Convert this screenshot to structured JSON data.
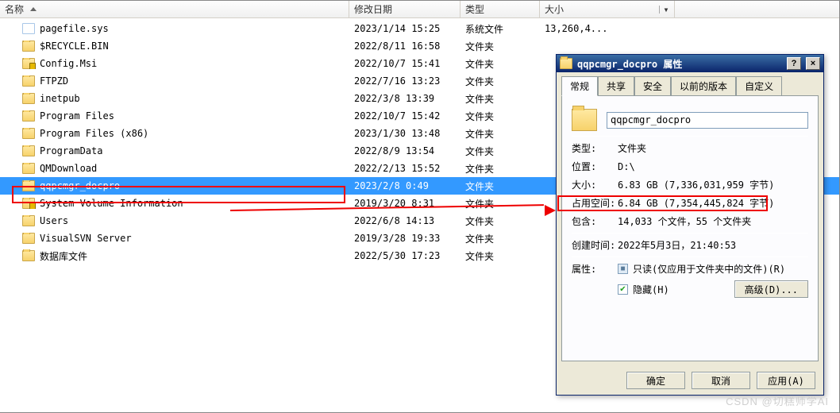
{
  "explorer": {
    "columns": {
      "name": "名称",
      "date": "修改日期",
      "type": "类型",
      "size": "大小"
    },
    "rows": [
      {
        "icon": "file",
        "name": "pagefile.sys",
        "date": "2023/1/14 15:25",
        "type": "系统文件",
        "size": "13,260,4..."
      },
      {
        "icon": "folder",
        "name": "$RECYCLE.BIN",
        "date": "2022/8/11 16:58",
        "type": "文件夹",
        "size": ""
      },
      {
        "icon": "folder-lock",
        "name": "Config.Msi",
        "date": "2022/10/7 15:41",
        "type": "文件夹",
        "size": ""
      },
      {
        "icon": "folder",
        "name": "FTPZD",
        "date": "2022/7/16 13:23",
        "type": "文件夹",
        "size": ""
      },
      {
        "icon": "folder",
        "name": "inetpub",
        "date": "2022/3/8 13:39",
        "type": "文件夹",
        "size": ""
      },
      {
        "icon": "folder",
        "name": "Program Files",
        "date": "2022/10/7 15:42",
        "type": "文件夹",
        "size": ""
      },
      {
        "icon": "folder",
        "name": "Program Files (x86)",
        "date": "2023/1/30 13:48",
        "type": "文件夹",
        "size": ""
      },
      {
        "icon": "folder",
        "name": "ProgramData",
        "date": "2022/8/9 13:54",
        "type": "文件夹",
        "size": ""
      },
      {
        "icon": "folder",
        "name": "QMDownload",
        "date": "2022/2/13 15:52",
        "type": "文件夹",
        "size": ""
      },
      {
        "icon": "folder",
        "name": "qqpcmgr_docpro",
        "date": "2023/2/8 0:49",
        "type": "文件夹",
        "size": "",
        "selected": true
      },
      {
        "icon": "folder-lock",
        "name": "System Volume Information",
        "date": "2019/3/20 8:31",
        "type": "文件夹",
        "size": ""
      },
      {
        "icon": "folder",
        "name": "Users",
        "date": "2022/6/8 14:13",
        "type": "文件夹",
        "size": ""
      },
      {
        "icon": "folder",
        "name": "VisualSVN Server",
        "date": "2019/3/28 19:33",
        "type": "文件夹",
        "size": ""
      },
      {
        "icon": "folder",
        "name": "数据库文件",
        "date": "2022/5/30 17:23",
        "type": "文件夹",
        "size": ""
      }
    ]
  },
  "props": {
    "title": "qqpcmgr_docpro 属性",
    "tabs": {
      "general": "常规",
      "share": "共享",
      "security": "安全",
      "prev": "以前的版本",
      "custom": "自定义"
    },
    "name_value": "qqpcmgr_docpro",
    "labels": {
      "type": "类型:",
      "location": "位置:",
      "size": "大小:",
      "ondisk": "占用空间:",
      "contains": "包含:",
      "created": "创建时间:",
      "attributes": "属性:"
    },
    "values": {
      "type": "文件夹",
      "location": "D:\\",
      "size": "6.83 GB (7,336,031,959 字节)",
      "ondisk": "6.84 GB (7,354,445,824 字节)",
      "contains": "14,033 个文件，55 个文件夹",
      "created": "2022年5月3日，21:40:53"
    },
    "readonly": "只读(仅应用于文件夹中的文件)(R)",
    "hidden": "隐藏(H)",
    "advanced": "高级(D)...",
    "ok": "确定",
    "cancel": "取消",
    "apply": "应用(A)"
  },
  "watermark": "CSDN @切糕师学AI"
}
